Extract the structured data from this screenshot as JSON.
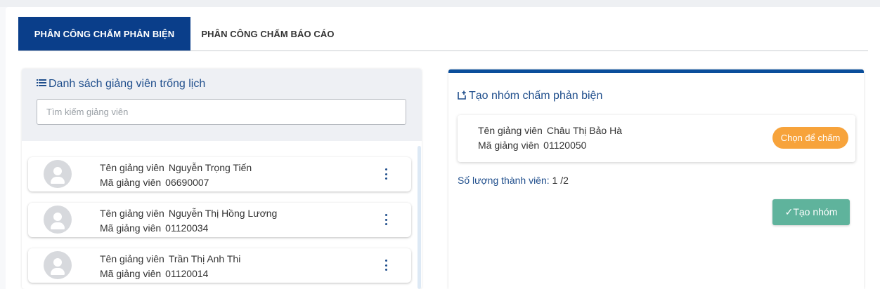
{
  "tabs": [
    {
      "label": "PHÂN CÔNG CHẤM PHẢN BIỆN",
      "active": true
    },
    {
      "label": "PHÂN CÔNG CHẤM BÁO CÁO",
      "active": false
    }
  ],
  "left_panel": {
    "title": "Danh sách giảng viên trống lịch",
    "search_placeholder": "Tìm kiếm giảng viên",
    "lecturers": [
      {
        "name_label": "Tên giảng viên",
        "name": "Nguyễn Trọng Tiến",
        "code_label": "Mã giảng viên",
        "code": "06690007"
      },
      {
        "name_label": "Tên giảng viên",
        "name": "Nguyễn Thị Hồng Lương",
        "code_label": "Mã giảng viên",
        "code": "01120034"
      },
      {
        "name_label": "Tên giảng viên",
        "name": "Trần Thị Anh Thi",
        "code_label": "Mã giảng viên",
        "code": "01120014"
      }
    ]
  },
  "right_panel": {
    "title": "Tạo nhóm chấm phản biện",
    "member": {
      "name_label": "Tên giảng viên",
      "name": "Châu Thị Bảo Hà",
      "code_label": "Mã giảng viên",
      "code": "01120050"
    },
    "choose_label": "Chọn để chấm",
    "count_label": "Số lượng thành viên:",
    "count_value": "1 /2",
    "create_label": "✓Tạo nhóm"
  },
  "colors": {
    "primary": "#0a3e8a",
    "accent_orange": "#f7a33b",
    "accent_green": "#5fb39c",
    "title_blue": "#1f4e8c"
  },
  "icons": [
    "list-icon",
    "add-box-icon",
    "person-icon",
    "more-vert-icon"
  ]
}
